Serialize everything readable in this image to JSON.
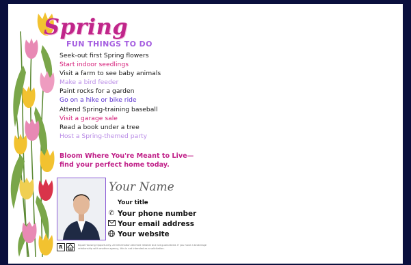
{
  "card": {
    "title": "Spring",
    "subtitle": "FUN THINGS TO DO",
    "activities": [
      {
        "text": "Seek-out first Spring flowers",
        "color": "#1a1a1a"
      },
      {
        "text": "Start indoor seedlings",
        "color": "#d6207a"
      },
      {
        "text": "Visit a farm to see baby animals",
        "color": "#1a1a1a"
      },
      {
        "text": "Make a bird feeder",
        "color": "#b98be6"
      },
      {
        "text": "Paint rocks for a garden",
        "color": "#1a1a1a"
      },
      {
        "text": "Go on a hike or bike ride",
        "color": "#5a2fd0"
      },
      {
        "text": "Attend Spring-training baseball",
        "color": "#1a1a1a"
      },
      {
        "text": "Visit a garage sale",
        "color": "#d6207a"
      },
      {
        "text": "Read a book under a tree",
        "color": "#1a1a1a"
      },
      {
        "text": "Host a Spring-themed party",
        "color": "#b98be6"
      }
    ],
    "tagline_line1": "Bloom Where You're Meant to Live—",
    "tagline_line2": "find your perfect home today."
  },
  "agent": {
    "signature": "Your Name",
    "title": "Your title",
    "phone": "Your phone number",
    "email": "Your email address",
    "website": "Your website",
    "icons": {
      "phone": "phone-icon",
      "email": "envelope-icon",
      "website": "globe-icon"
    }
  },
  "footer": {
    "logo_letters": "R",
    "disclaimer": "Equal Housing Opportunity. All information deemed reliable but not guaranteed. If you have a brokerage relationship with another agency, this is not intended as a solicitation."
  },
  "colors": {
    "background": "#0a0f3d",
    "brand_pink": "#c0268a",
    "brand_purple": "#8a5ad6",
    "tulip_pink": "#e889b4",
    "tulip_yellow": "#f2c230",
    "tulip_red": "#d9344a",
    "leaf_green": "#6f9a3f"
  }
}
